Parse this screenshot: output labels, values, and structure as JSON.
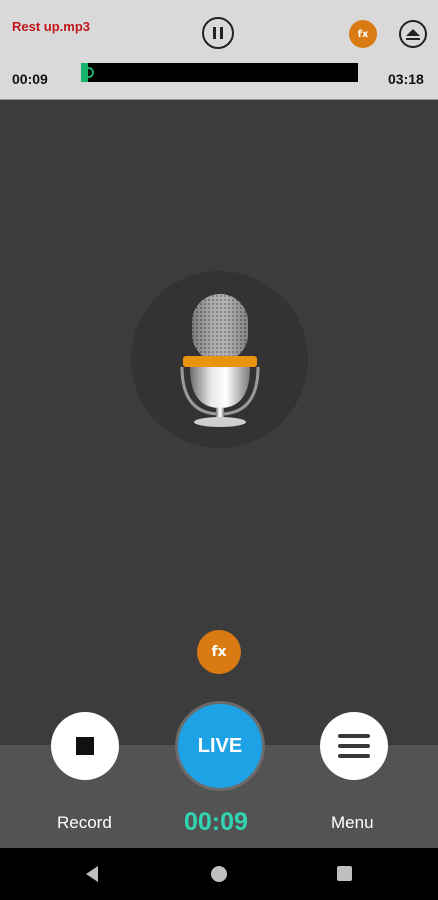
{
  "player": {
    "track_name": "Rest up.mp3",
    "elapsed": "00:09",
    "total": "03:18",
    "progress_fraction": 0.045,
    "fx_label": "fx",
    "pause_icon": "pause-icon",
    "eject_icon": "eject-icon"
  },
  "main": {
    "mic_icon": "microphone-icon",
    "fx_label": "fx"
  },
  "controls": {
    "record_label": "Record",
    "menu_label": "Menu",
    "live_label": "LIVE",
    "recording_time": "00:09",
    "record_icon": "stop-icon",
    "menu_icon": "hamburger-icon"
  },
  "nav": {
    "back_icon": "back-icon",
    "home_icon": "home-icon",
    "recents_icon": "recents-icon"
  },
  "colors": {
    "accent_orange": "#d97a12",
    "live_blue": "#1ea2e6",
    "time_teal": "#32d5b1",
    "progress_green": "#18b36a",
    "track_red": "#c0171c"
  }
}
